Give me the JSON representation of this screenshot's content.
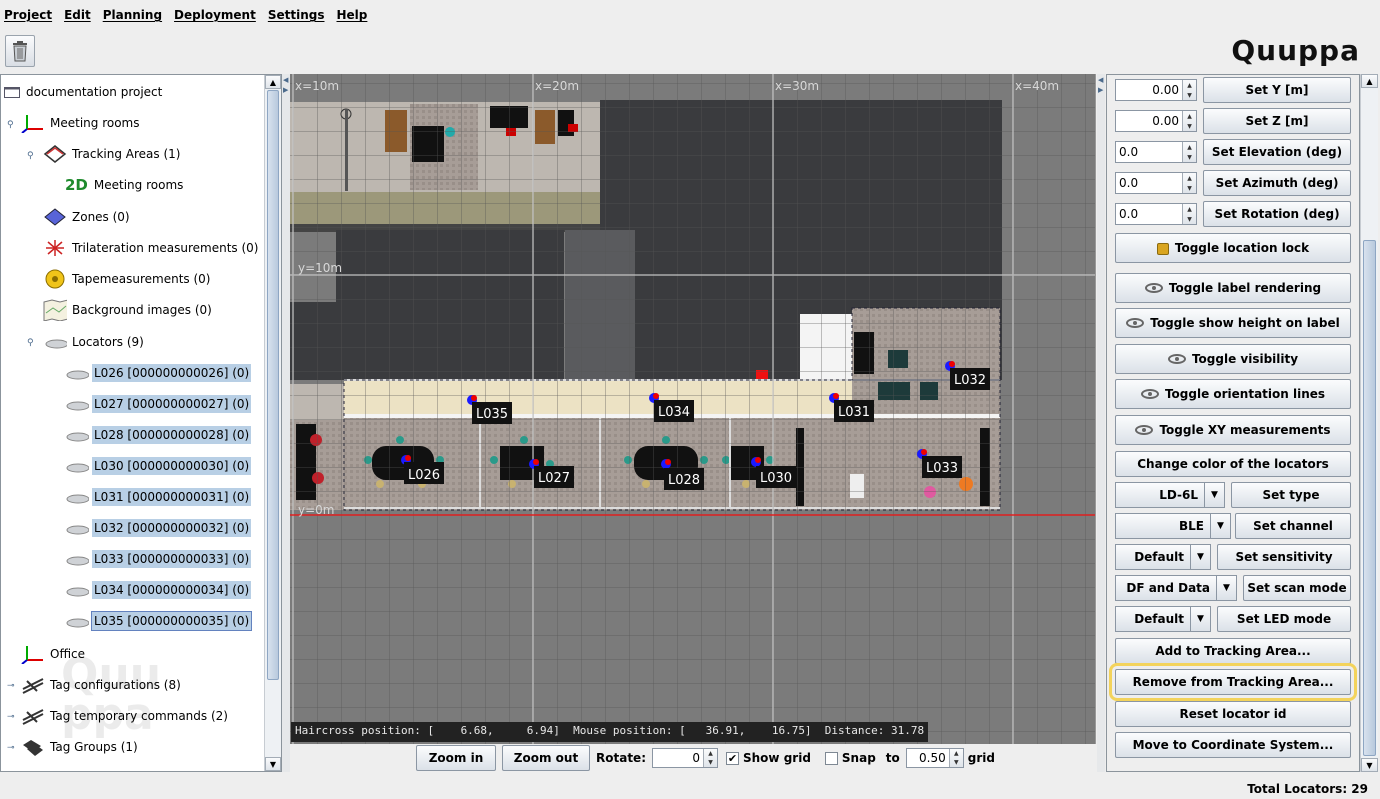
{
  "menu": [
    "Project",
    "Edit",
    "Planning",
    "Deployment",
    "Settings",
    "Help"
  ],
  "brand": "Quuppa",
  "tree": {
    "root": "documentation project",
    "meeting_rooms": "Meeting rooms",
    "tracking_areas": "Tracking Areas (1)",
    "tracking_area_badge": "2D",
    "tracking_area_name": "Meeting rooms",
    "zones": "Zones (0)",
    "trilateration": "Trilateration measurements (0)",
    "tapemeasurements": "Tapemeasurements (0)",
    "background_images": "Background images (0)",
    "locators": "Locators (9)",
    "locator_items": [
      "L026 [000000000026] (0)",
      "L027 [000000000027] (0)",
      "L028 [000000000028] (0)",
      "L030 [000000000030] (0)",
      "L031 [000000000031] (0)",
      "L032 [000000000032] (0)",
      "L033 [000000000033] (0)",
      "L034 [000000000034] (0)",
      "L035 [000000000035] (0)"
    ],
    "office": "Office",
    "tag_configurations": "Tag configurations (8)",
    "tag_temporary_commands": "Tag temporary commands (2)",
    "tag_groups": "Tag Groups (1)"
  },
  "map": {
    "axis_labels": [
      "x=10m",
      "x=20m",
      "x=30m",
      "x=40m",
      "y=10m",
      "y=0m"
    ],
    "locators": [
      "L026",
      "L027",
      "L028",
      "L030",
      "L031",
      "L032",
      "L033",
      "L034",
      "L035"
    ],
    "status": "Haircross position: [    6.68,     6.94]  Mouse position: [   36.91,    16.75]  Distance: 31.78"
  },
  "map_controls": {
    "zoom_in": "Zoom in",
    "zoom_out": "Zoom out",
    "rotate_label": "Rotate:",
    "rotate_value": "0",
    "show_grid": "Show grid",
    "snap": "Snap",
    "to": "to",
    "grid_value": "0.50",
    "grid": "grid"
  },
  "right_panel": {
    "y_value": "0.00",
    "set_y": "Set Y [m]",
    "z_value": "0.00",
    "set_z": "Set Z [m]",
    "elevation_value": "0.0",
    "set_elevation": "Set Elevation (deg)",
    "azimuth_value": "0.0",
    "set_azimuth": "Set Azimuth (deg)",
    "rotation_value": "0.0",
    "set_rotation": "Set Rotation (deg)",
    "toggle_lock": "Toggle location lock",
    "toggle_label": "Toggle label rendering",
    "toggle_height": "Toggle show height on label",
    "toggle_visibility": "Toggle visibility",
    "toggle_orientation": "Toggle orientation lines",
    "toggle_xy": "Toggle XY measurements",
    "change_color": "Change color of the locators",
    "type_value": "LD-6L",
    "set_type": "Set type",
    "channel_value": "BLE",
    "set_channel": "Set channel",
    "sensitivity_value": "Default",
    "set_sensitivity": "Set sensitivity",
    "scan_value": "DF and Data",
    "set_scan": "Set scan mode",
    "led_value": "Default",
    "set_led": "Set LED mode",
    "add_tracking": "Add to Tracking Area...",
    "remove_tracking": "Remove from Tracking Area...",
    "reset_id": "Reset locator id",
    "move_cs": "Move to Coordinate System..."
  },
  "status_bar": "Total Locators: 29"
}
